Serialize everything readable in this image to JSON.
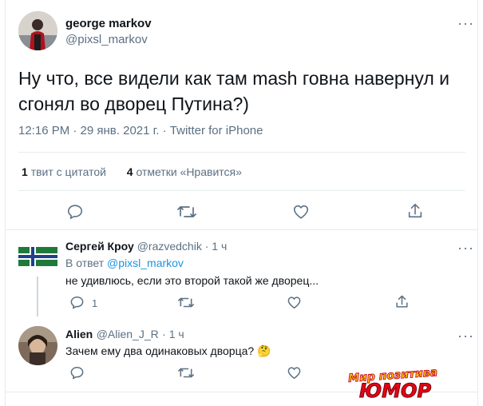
{
  "main_tweet": {
    "author_name": "george markov",
    "author_handle": "@pixsl_markov",
    "text_line1": "Ну что, все видели как там mash говна навернул и",
    "text_line2": "сгонял во дворец Путина?)",
    "timestamp": "12:16 PM · 29 янв. 2021 г. · Twitter for iPhone",
    "quote_count": "1",
    "quote_label": "твит с цитатой",
    "like_count": "4",
    "like_label": "отметки «Нравится»"
  },
  "replies": [
    {
      "author_name": "Сергей Кроу",
      "author_handle": "@razvedchik",
      "time": "· 1 ч",
      "reply_to_prefix": "В ответ",
      "reply_to_handle": "@pixsl_markov",
      "text": "не удивлюсь, если это второй такой же дворец...",
      "reply_count": "1"
    },
    {
      "author_name": "Alien",
      "author_handle": "@Alien_J_R",
      "time": "· 1 ч",
      "text": "Зачем ему два одинаковых дворца?",
      "emoji": "🤔"
    }
  ],
  "watermark": {
    "line1": "Мир позитива",
    "line2": "ЮМОР"
  },
  "icons": [
    "more-icon",
    "reply-icon",
    "retweet-icon",
    "like-icon",
    "share-icon",
    "flag-icon"
  ],
  "colors": {
    "accent": "#1b95e0",
    "muted": "#5b7083",
    "border": "#e6ecf0",
    "flag_green": "#1f7a3a",
    "flag_blue": "#1f3f8f"
  }
}
